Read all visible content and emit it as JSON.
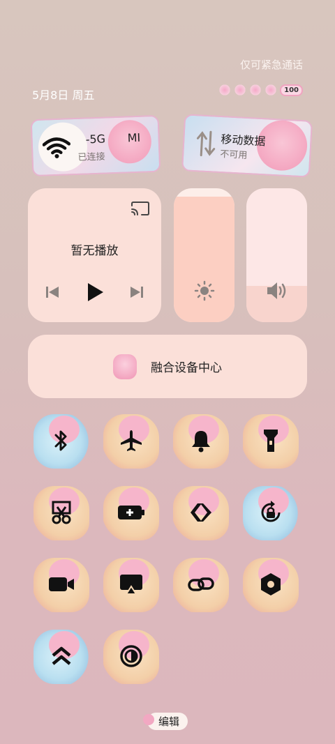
{
  "status": {
    "emergency_only": "仅可紧急通话",
    "date": "5月8日 周五",
    "battery": "100"
  },
  "network": {
    "wifi": {
      "name_left": "-5G",
      "name_right": "MI",
      "status": "已连接"
    },
    "mobile_data": {
      "name": "移动数据",
      "status": "不可用"
    }
  },
  "media": {
    "title": "暂无播放"
  },
  "sliders": {
    "brightness_level": 0.94,
    "volume_level": 0.27
  },
  "fusion": {
    "label": "融合设备中心"
  },
  "toggles": [
    {
      "name": "bluetooth",
      "icon": "bluetooth-icon",
      "active": true
    },
    {
      "name": "airplane",
      "icon": "airplane-icon",
      "active": false
    },
    {
      "name": "sound",
      "icon": "bell-icon",
      "active": false
    },
    {
      "name": "flashlight",
      "icon": "flashlight-icon",
      "active": false
    },
    {
      "name": "screenshot",
      "icon": "scissors-icon",
      "active": false
    },
    {
      "name": "battery-saver",
      "icon": "battery-plus-icon",
      "active": false
    },
    {
      "name": "developer",
      "icon": "code-icon",
      "active": false
    },
    {
      "name": "rotation-lock",
      "icon": "rotation-lock-icon",
      "active": true
    },
    {
      "name": "screen-record",
      "icon": "video-icon",
      "active": false
    },
    {
      "name": "screen-cast",
      "icon": "airplay-icon",
      "active": false
    },
    {
      "name": "link",
      "icon": "link-icon",
      "active": false
    },
    {
      "name": "settings",
      "icon": "hexagon-icon",
      "active": false
    },
    {
      "name": "performance",
      "icon": "double-chevron-up-icon",
      "active": true
    },
    {
      "name": "dark-mode",
      "icon": "contrast-icon",
      "active": false
    }
  ],
  "edit_label": "编辑"
}
